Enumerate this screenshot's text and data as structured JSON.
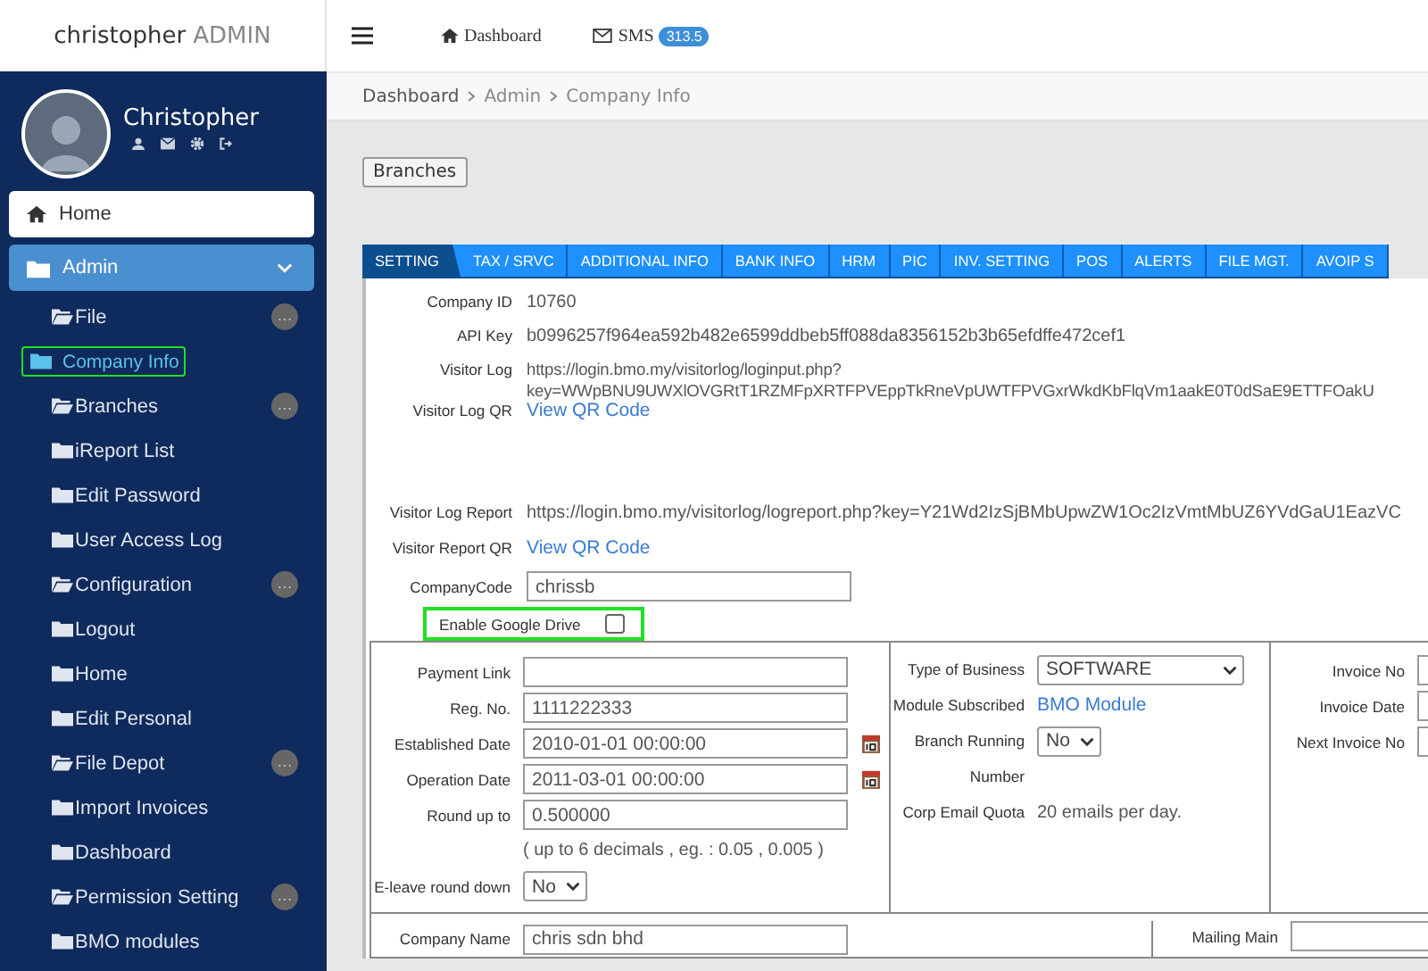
{
  "header": {
    "brand_name": "christopher",
    "brand_suffix": "ADMIN",
    "nav": [
      {
        "kind": "home",
        "label": "Dashboard"
      },
      {
        "kind": "sms",
        "label": "SMS",
        "badge": "313.5"
      }
    ]
  },
  "profile": {
    "name": "Christopher"
  },
  "sidebar": {
    "items": [
      {
        "kind": "link",
        "label": "Home"
      },
      {
        "kind": "group",
        "label": "Admin",
        "expanded": true,
        "children": [
          {
            "label": "File",
            "has_submenu": true,
            "selected": false,
            "highlighted": false
          },
          {
            "label": "Company Info",
            "has_submenu": false,
            "selected": true,
            "highlighted": true
          },
          {
            "label": "Branches",
            "has_submenu": true,
            "selected": false,
            "highlighted": false
          },
          {
            "label": "iReport List",
            "has_submenu": false,
            "selected": false,
            "highlighted": false
          },
          {
            "label": "Edit Password",
            "has_submenu": false,
            "selected": false,
            "highlighted": false
          },
          {
            "label": "User Access Log",
            "has_submenu": false,
            "selected": false,
            "highlighted": false
          },
          {
            "label": "Configuration",
            "has_submenu": true,
            "selected": false,
            "highlighted": false
          },
          {
            "label": "Logout",
            "has_submenu": false,
            "selected": false,
            "highlighted": false
          },
          {
            "label": "Home",
            "has_submenu": false,
            "selected": false,
            "highlighted": false
          },
          {
            "label": "Edit Personal",
            "has_submenu": false,
            "selected": false,
            "highlighted": false
          },
          {
            "label": "File Depot",
            "has_submenu": true,
            "selected": false,
            "highlighted": false
          },
          {
            "label": "Import Invoices",
            "has_submenu": false,
            "selected": false,
            "highlighted": false
          },
          {
            "label": "Dashboard",
            "has_submenu": false,
            "selected": false,
            "highlighted": false
          },
          {
            "label": "Permission Setting",
            "has_submenu": true,
            "selected": false,
            "highlighted": false
          },
          {
            "label": "BMO modules",
            "has_submenu": false,
            "selected": false,
            "highlighted": false
          }
        ]
      }
    ]
  },
  "breadcrumb": [
    "Dashboard",
    "Admin",
    "Company Info"
  ],
  "page": {
    "button": "Branches",
    "tabs": [
      {
        "label": "SETTING",
        "selected": true
      },
      {
        "label": "TAX / SRVC",
        "selected": false
      },
      {
        "label": "ADDITIONAL INFO",
        "selected": false
      },
      {
        "label": "BANK INFO",
        "selected": false
      },
      {
        "label": "HRM",
        "selected": false
      },
      {
        "label": "PIC",
        "selected": false
      },
      {
        "label": "INV. SETTING",
        "selected": false
      },
      {
        "label": "POS",
        "selected": false
      },
      {
        "label": "ALERTS",
        "selected": false
      },
      {
        "label": "FILE MGT.",
        "selected": false
      },
      {
        "label": "AVOIP S",
        "selected": false
      }
    ],
    "fields": [
      {
        "label": "Company ID",
        "kind": "text",
        "value": "10760"
      },
      {
        "label": "API Key",
        "kind": "text",
        "value": "b0996257f964ea592b482e6599ddbeb5ff088da8356152b3b65efdffe472cef1"
      },
      {
        "label": "Visitor Log",
        "kind": "lines",
        "lines": [
          "https://login.bmo.my/visitorlog/loginput.php?",
          "key=WWpBNU9UWXlOVGRtT1RZMFpXRTFPVEppTkRneVpUWTFPVGxrWkdKbFlqVm1aakE0T0dSaE9ETTFOakU"
        ]
      },
      {
        "label": "Visitor Log QR",
        "kind": "link",
        "value": "View QR Code"
      },
      {
        "label": "Visitor Log Report",
        "kind": "text",
        "value": "https://login.bmo.my/visitorlog/logreport.php?key=Y21Wd2IzSjBMbUpwZW1Oc2IzVmtMbUZ6YVdGaU1EazVC"
      },
      {
        "label": "Visitor Report QR",
        "kind": "link",
        "value": "View QR Code"
      },
      {
        "label": "CompanyCode",
        "kind": "input",
        "value": "chrissb"
      }
    ],
    "google_drive": {
      "label": "Enable Google Drive",
      "checked": false,
      "highlighted": true
    },
    "details": {
      "left": [
        {
          "label": "Payment Link",
          "kind": "input"
        },
        {
          "label": "Reg. No.",
          "kind": "input",
          "value": "1111222333"
        },
        {
          "label": "Established Date",
          "kind": "date",
          "value": "2010-01-01 00:00:00"
        },
        {
          "label": "Operation Date",
          "kind": "date",
          "value": "2011-03-01 00:00:00"
        },
        {
          "label": "Round up to",
          "kind": "input",
          "value": "0.500000"
        },
        {
          "kind": "hint",
          "value": "( up to 6 decimals , eg. : 0.05 , 0.005 )"
        },
        {
          "label": "E-leave round down",
          "kind": "select",
          "value": "No"
        }
      ],
      "middle": [
        {
          "label": "Type of Business",
          "kind": "select-wide",
          "value": "SOFTWARE"
        },
        {
          "label": "Module Subscribed",
          "kind": "link",
          "value": "BMO Module"
        },
        {
          "label": "Branch Running",
          "kind": "select",
          "value": "No"
        },
        {
          "label": "Number",
          "kind": "text"
        },
        {
          "label": "Corp Email Quota",
          "kind": "text",
          "value": "20 emails per day."
        }
      ],
      "right": [
        {
          "label": "Invoice No",
          "kind": "input"
        },
        {
          "label": "Invoice Date",
          "kind": "input"
        },
        {
          "label": "Next Invoice No",
          "kind": "input"
        }
      ]
    },
    "bottom": [
      {
        "label": "Company Name",
        "kind": "input",
        "value": "chris sdn bhd"
      },
      {
        "label": "Mailing Main",
        "kind": "input"
      }
    ]
  }
}
